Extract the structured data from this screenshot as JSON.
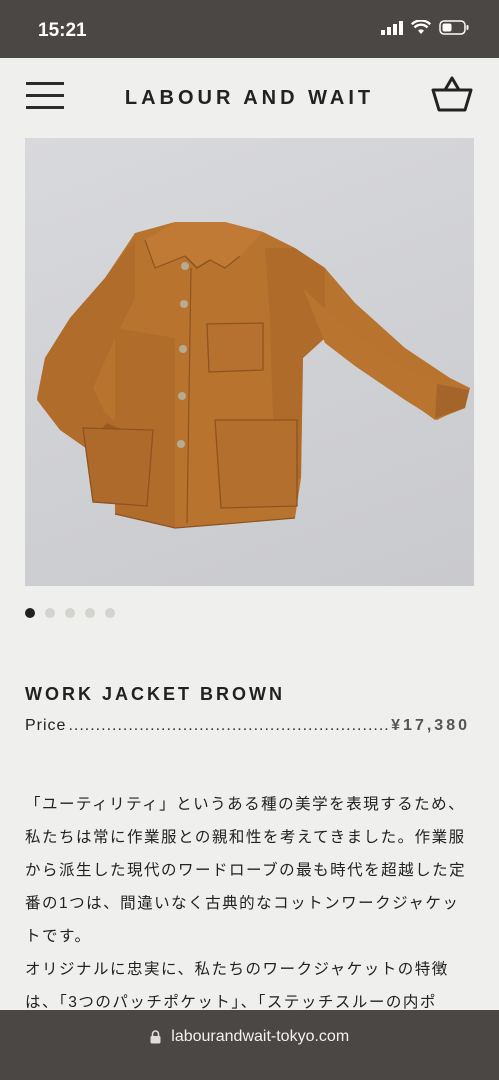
{
  "status_bar": {
    "time": "15:21"
  },
  "header": {
    "brand": "LABOUR AND WAIT"
  },
  "product": {
    "title": "WORK JACKET BROWN",
    "price_label": "Price",
    "price_leader": "..................................................................",
    "price": "¥17,380",
    "image_count": 5,
    "active_image": 1
  },
  "description": {
    "paragraph1": "「ユーティリティ」というある種の美学を表現するため、私たちは常に作業服との親和性を考えてきました。作業服から派生した現代のワードローブの最も時代を超越した定番の1つは、間違いなく古典的なコットンワークジャケットです。",
    "paragraph2": "オリジナルに忠実に、私たちのワークジャケットの特徴は、「3つのパッチポケット」、「ステッチスルーの内ポ"
  },
  "browser": {
    "url": "labourandwait-tokyo.com"
  },
  "colors": {
    "status_bg": "#4a4745",
    "page_bg": "#efefed",
    "jacket": "#b8732f"
  }
}
